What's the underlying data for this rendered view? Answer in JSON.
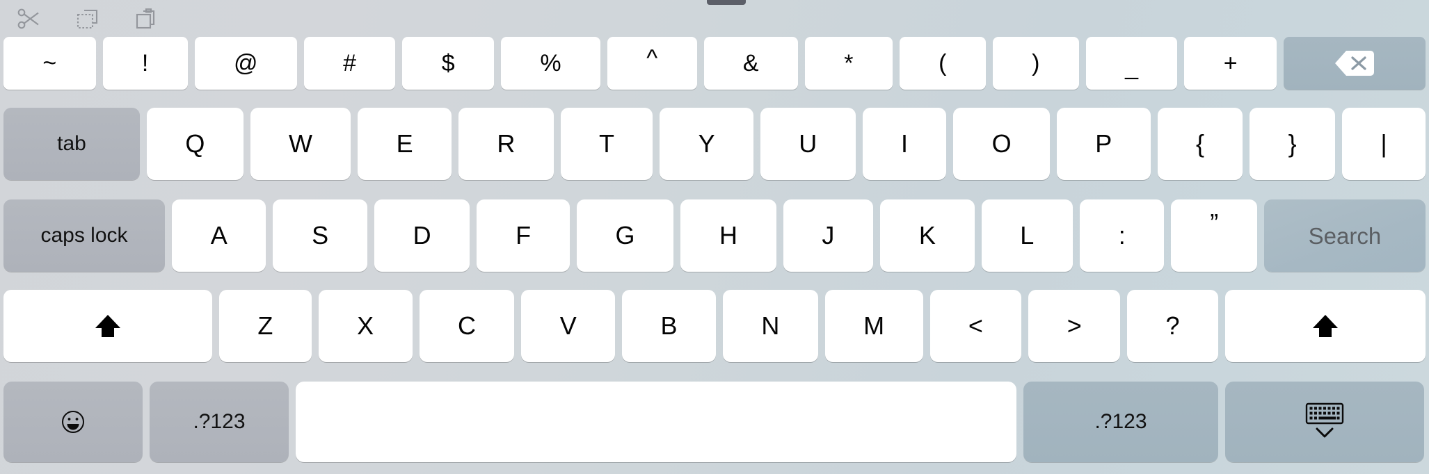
{
  "keyboard": {
    "type": "ipad-software-keyboard",
    "layout": "QWERTY shifted / symbols",
    "colors": {
      "key_face": "#ffffff",
      "modifier_gray": "#b0b4bb",
      "modifier_bluegray": "#a4b6c1",
      "background_left": "#d2d5d9",
      "background_right": "#ccd8dd",
      "key_text": "#040404",
      "return_text": "#5b5f63"
    }
  },
  "toolbar": {
    "items": [
      {
        "name": "cut-icon",
        "label": "Cut"
      },
      {
        "name": "copy-icon",
        "label": "Copy"
      },
      {
        "name": "paste-icon",
        "label": "Paste"
      }
    ]
  },
  "rows": {
    "number_row": {
      "keys": [
        "~",
        "!",
        "@",
        "#",
        "$",
        "%",
        "^",
        "&",
        "*",
        "(",
        ")",
        "_",
        "+"
      ],
      "backspace": {
        "label": "",
        "icon": "delete-left-icon"
      }
    },
    "top_row": {
      "tab": "tab",
      "keys": [
        "Q",
        "W",
        "E",
        "R",
        "T",
        "Y",
        "U",
        "I",
        "O",
        "P",
        "{",
        "}",
        "|"
      ]
    },
    "home_row": {
      "caps_lock": "caps lock",
      "keys": [
        "A",
        "S",
        "D",
        "F",
        "G",
        "H",
        "J",
        "K",
        "L",
        ":",
        "”"
      ],
      "return": "Search"
    },
    "bottom_row": {
      "left_shift": {
        "label": "",
        "icon": "shift-up-arrow-icon"
      },
      "keys": [
        "Z",
        "X",
        "C",
        "V",
        "B",
        "N",
        "M",
        "<",
        ">",
        "?"
      ],
      "right_shift": {
        "label": "",
        "icon": "shift-up-arrow-icon"
      }
    },
    "space_row": {
      "emoji": {
        "label": "",
        "icon": "emoji-smiley-icon"
      },
      "numeric_left": ".?123",
      "space": "",
      "numeric_right": ".?123",
      "dismiss": {
        "label": "",
        "icon": "hide-keyboard-icon"
      }
    }
  }
}
